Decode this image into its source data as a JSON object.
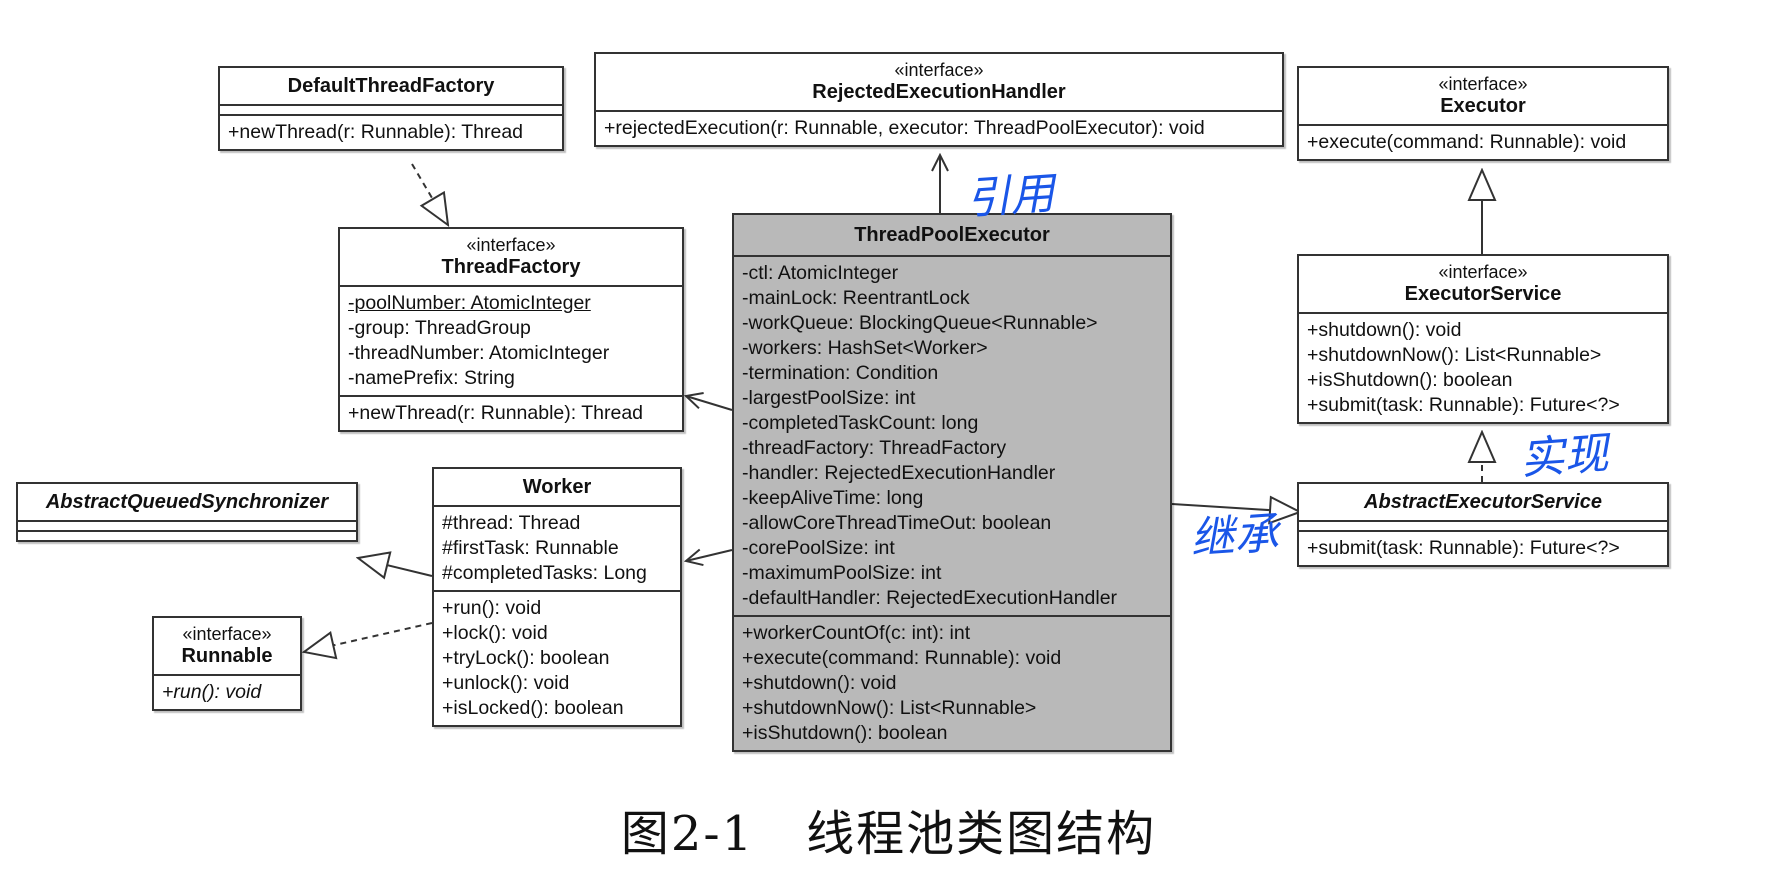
{
  "stereotype": "«interface»",
  "classes": {
    "default_thread_factory": {
      "name": "DefaultThreadFactory",
      "methods": [
        "+newThread(r: Runnable): Thread"
      ]
    },
    "rejected_execution_handler": {
      "name": "RejectedExecutionHandler",
      "methods": [
        "+rejectedExecution(r: Runnable, executor: ThreadPoolExecutor): void"
      ]
    },
    "executor": {
      "name": "Executor",
      "methods": [
        "+execute(command: Runnable): void"
      ]
    },
    "thread_factory": {
      "name": "ThreadFactory",
      "attributes": [
        "-poolNumber: AtomicInteger",
        "-group: ThreadGroup",
        "-threadNumber: AtomicInteger",
        "-namePrefix: String"
      ],
      "methods": [
        "+newThread(r: Runnable): Thread"
      ]
    },
    "thread_pool_executor": {
      "name": "ThreadPoolExecutor",
      "attributes": [
        "-ctl: AtomicInteger",
        "-mainLock: ReentrantLock",
        "-workQueue: BlockingQueue<Runnable>",
        "-workers: HashSet<Worker>",
        "-termination: Condition",
        "-largestPoolSize: int",
        "-completedTaskCount: long",
        "-threadFactory: ThreadFactory",
        "-handler: RejectedExecutionHandler",
        "-keepAliveTime: long",
        "-allowCoreThreadTimeOut: boolean",
        "-corePoolSize: int",
        "-maximumPoolSize: int",
        "-defaultHandler: RejectedExecutionHandler"
      ],
      "methods": [
        "+workerCountOf(c: int): int",
        "+execute(command: Runnable): void",
        "+shutdown(): void",
        "+shutdownNow(): List<Runnable>",
        "+isShutdown(): boolean"
      ]
    },
    "executor_service": {
      "name": "ExecutorService",
      "methods": [
        "+shutdown(): void",
        "+shutdownNow(): List<Runnable>",
        "+isShutdown(): boolean",
        "+submit(task: Runnable): Future<?>"
      ]
    },
    "abstract_queued_synchronizer": {
      "name": "AbstractQueuedSynchronizer"
    },
    "worker": {
      "name": "Worker",
      "attributes": [
        "#thread: Thread",
        "#firstTask: Runnable",
        "#completedTasks: Long"
      ],
      "methods": [
        "+run(): void",
        "+lock(): void",
        "+tryLock(): boolean",
        "+unlock(): void",
        "+isLocked(): boolean"
      ]
    },
    "abstract_executor_service": {
      "name": "AbstractExecutorService",
      "methods": [
        "+submit(task: Runnable): Future<?>"
      ]
    },
    "runnable": {
      "name": "Runnable",
      "methods": [
        "+run(): void"
      ]
    }
  },
  "annotations": {
    "reference": "引用",
    "implements": "实现",
    "inherits": "继承"
  },
  "caption": {
    "label": "图2-1",
    "title": "线程池类图结构"
  },
  "colors": {
    "highlight_fill": "#b9b9b9",
    "line": "#333333",
    "handwriting": "#1a56e8"
  }
}
